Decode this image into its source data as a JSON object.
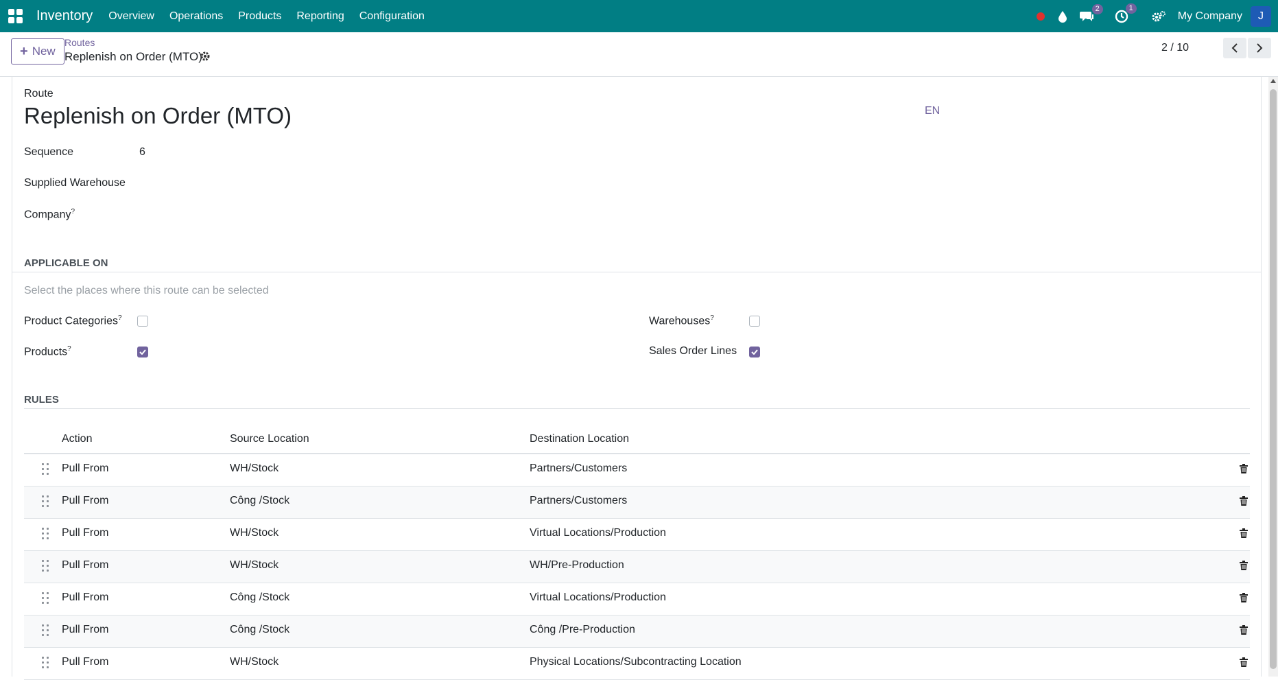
{
  "navbar": {
    "app_name": "Inventory",
    "menus": [
      "Overview",
      "Operations",
      "Products",
      "Reporting",
      "Configuration"
    ],
    "messages_badge": "2",
    "activities_badge": "1",
    "company": "My Company",
    "avatar_letter": "J",
    "color": "#017e84"
  },
  "control": {
    "new_label": "New",
    "breadcrumb": "Routes",
    "record_title": "Replenish on Order (MTO)",
    "pager": "2 / 10"
  },
  "form": {
    "route_label": "Route",
    "name": "Replenish on Order (MTO)",
    "lang": "EN",
    "sequence_label": "Sequence",
    "sequence_value": "6",
    "warehouse_label": "Supplied Warehouse",
    "company_label": "Company",
    "tooltip_mark": "?",
    "applicable_title": "Applicable On",
    "applicable_hint": "Select the places where this route can be selected",
    "applicable": {
      "product_categories": {
        "label": "Product Categories",
        "checked": false
      },
      "products": {
        "label": "Products",
        "checked": true
      },
      "warehouses": {
        "label": "Warehouses",
        "checked": false
      },
      "sale_lines": {
        "label": "Sales Order Lines",
        "checked": true
      }
    },
    "rules_title": "Rules"
  },
  "rules": {
    "headers": [
      "Action",
      "Source Location",
      "Destination Location"
    ],
    "rows": [
      {
        "action": "Pull From",
        "source": "WH/Stock",
        "dest": "Partners/Customers"
      },
      {
        "action": "Pull From",
        "source": "Công /Stock",
        "dest": "Partners/Customers"
      },
      {
        "action": "Pull From",
        "source": "WH/Stock",
        "dest": "Virtual Locations/Production"
      },
      {
        "action": "Pull From",
        "source": "WH/Stock",
        "dest": "WH/Pre-Production"
      },
      {
        "action": "Pull From",
        "source": "Công /Stock",
        "dest": "Virtual Locations/Production"
      },
      {
        "action": "Pull From",
        "source": "Công /Stock",
        "dest": "Công /Pre-Production"
      },
      {
        "action": "Pull From",
        "source": "WH/Stock",
        "dest": "Physical Locations/Subcontracting Location"
      }
    ]
  },
  "colors": {
    "accent": "#71639e",
    "record_dot": "#e0312e"
  }
}
